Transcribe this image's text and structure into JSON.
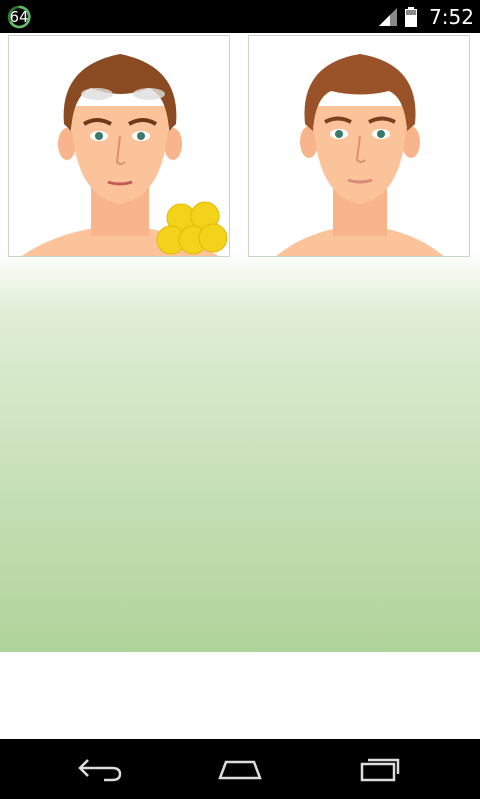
{
  "status_bar": {
    "notification_count": "64",
    "time": "7:52",
    "icons": [
      "signal-icon",
      "battery-icon"
    ]
  },
  "cards": [
    {
      "name": "face-before-card",
      "description_icon": "face-with-gray-hair-and-pores-icon"
    },
    {
      "name": "face-after-card",
      "description_icon": "face-clean-skin-icon"
    }
  ],
  "nav_bar": {
    "buttons": [
      "back-icon",
      "home-icon",
      "recent-apps-icon"
    ]
  },
  "colors": {
    "gradient_top": "#ffffff",
    "gradient_bottom": "#b0d39a",
    "hair": "#8a4a22",
    "skin": "#fbc39a",
    "blob": "#f3d21b"
  }
}
